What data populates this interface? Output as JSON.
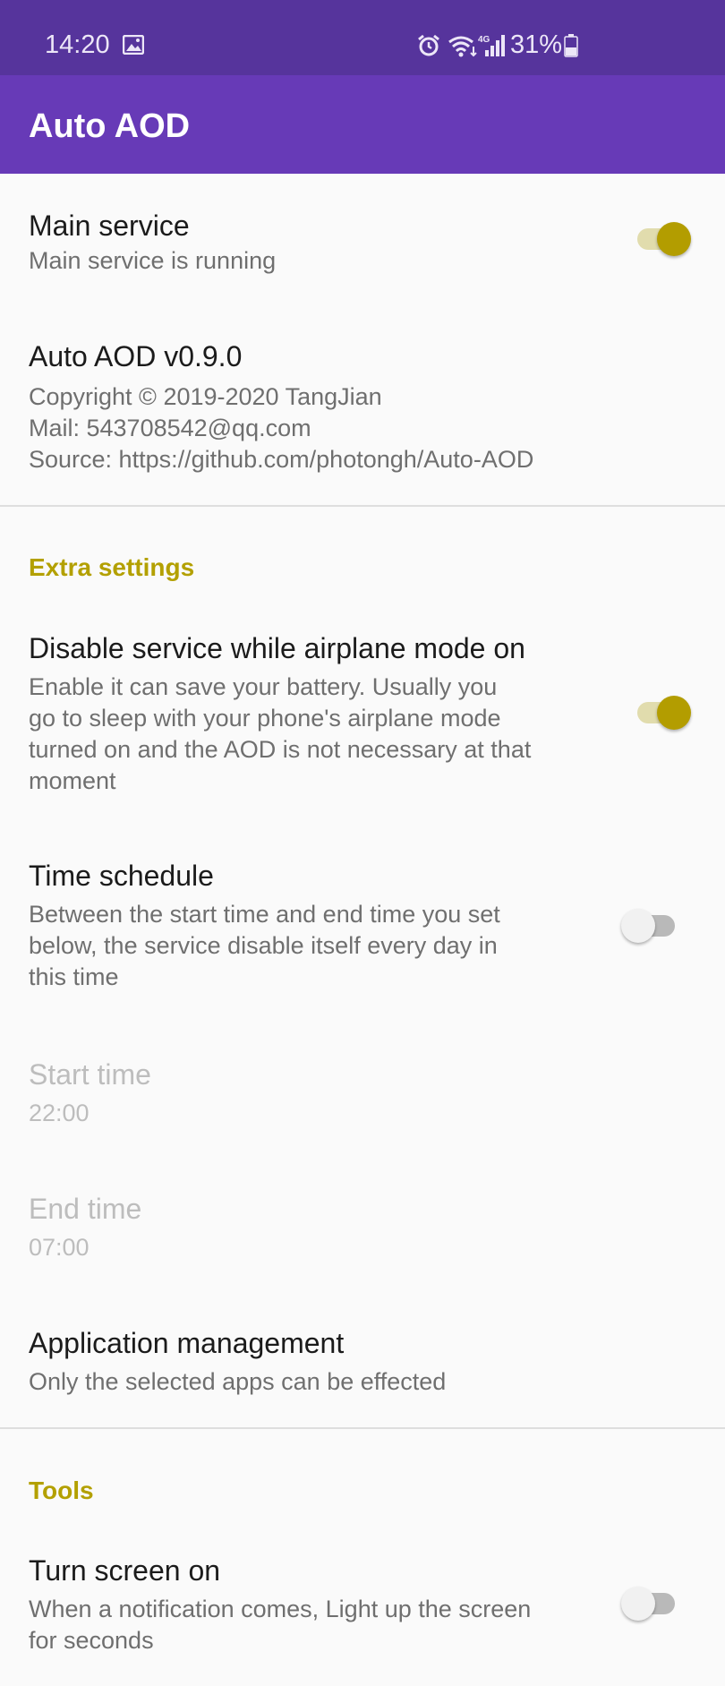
{
  "status_bar": {
    "time": "14:20",
    "battery_percent": "31%",
    "icons": [
      "image-icon",
      "alarm-icon",
      "wifi-icon",
      "signal-4g-icon",
      "battery-icon"
    ]
  },
  "app_bar": {
    "title": "Auto AOD"
  },
  "prefs": {
    "main_service": {
      "title": "Main service",
      "summary": "Main service is running",
      "checked": true
    },
    "about": {
      "title": "Auto AOD v0.9.0",
      "copyright": "Copyright © 2019-2020 TangJian",
      "mail": "Mail: 543708542@qq.com",
      "source": "Source: https://github.com/photongh/Auto-AOD"
    }
  },
  "extra_settings": {
    "header": "Extra settings",
    "airplane": {
      "title": "Disable service while airplane mode on",
      "summary_lines": [
        "Enable it can save your battery. Usually you",
        "go to sleep with your phone's airplane mode",
        "turned on and the AOD is not necessary at that",
        "moment"
      ],
      "checked": true
    },
    "schedule": {
      "title": "Time schedule",
      "summary_lines": [
        "Between the start time and end time you set",
        "below, the service disable itself every day in",
        "this time"
      ],
      "checked": false
    },
    "start_time": {
      "title": "Start time",
      "value": "22:00"
    },
    "end_time": {
      "title": "End time",
      "value": "07:00"
    },
    "app_management": {
      "title": "Application management",
      "summary": "Only the selected apps can be effected"
    }
  },
  "tools": {
    "header": "Tools",
    "screen_on": {
      "title": "Turn screen on",
      "summary_lines": [
        "When a notification comes, Light up the screen",
        "for seconds"
      ],
      "checked": false
    }
  },
  "colors": {
    "status_bar": "#56349c",
    "app_bar": "#673ab7",
    "accent": "#b39d00",
    "category": "#b3a000"
  }
}
